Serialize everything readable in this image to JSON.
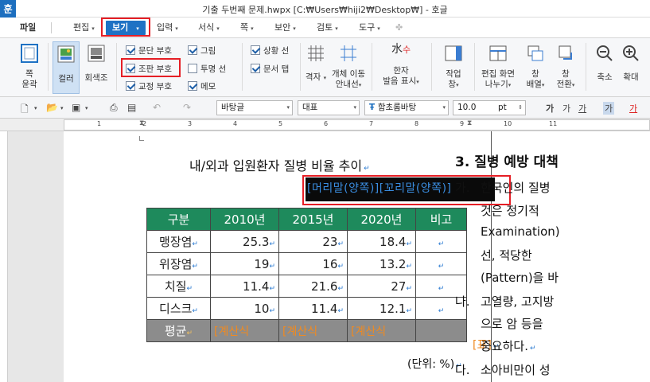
{
  "window": {
    "app_icon": "훈",
    "title": "기출 두번째 문제.hwpx [C:₩Users₩hiji2₩Desktop₩] - 호글"
  },
  "menu": {
    "file": "파일",
    "edit": "편집",
    "view": "보기",
    "input": "입력",
    "format": "서식",
    "page": "쪽",
    "security": "보안",
    "review": "검토",
    "tools": "도구"
  },
  "ribbon": {
    "page_outline": [
      "쪽",
      "윤곽"
    ],
    "color": "컬러",
    "grayscale": "회색조",
    "checks": {
      "paragraph_mark": {
        "label": "문단 부호",
        "checked": true
      },
      "markup_mark": {
        "label": "조판 부호",
        "checked": true
      },
      "proof_mark": {
        "label": "교정 부호",
        "checked": true
      },
      "picture": {
        "label": "그림",
        "checked": true
      },
      "transparent_line": {
        "label": "투명 선",
        "checked": false
      },
      "memo": {
        "label": "메모",
        "checked": true
      },
      "status_line": {
        "label": "상황 선",
        "checked": true
      },
      "doc_tab": {
        "label": "문서 탭",
        "checked": true
      }
    },
    "grid": "격자",
    "object_move": [
      "개체 이동",
      "안내선"
    ],
    "hanja": [
      "한자",
      "발음 표시"
    ],
    "work_window": [
      "작업",
      "창"
    ],
    "split_screen": [
      "편집 화면",
      "나누기"
    ],
    "window_arrange": [
      "창",
      "배열"
    ],
    "window_switch": [
      "창",
      "전환"
    ],
    "zoom_out": "축소",
    "zoom_in": "확대"
  },
  "format_bar": {
    "style": "바탕글",
    "lang": "대표",
    "font": "함초롬바탕",
    "size": "10.0",
    "unit": "pt"
  },
  "ruler": {
    "numbers": [
      "1",
      "2",
      "3",
      "4",
      "5",
      "6",
      "7",
      "8",
      "9",
      "10",
      "11"
    ]
  },
  "document": {
    "title": "내/외과 입원환자 질병 비율 추이",
    "fields": "[머리말(양쪽)][꼬리말(양쪽)]",
    "table": {
      "headers": [
        "구분",
        "2010년",
        "2015년",
        "2020년",
        "비고"
      ],
      "rows": [
        [
          "맹장염",
          "25.3",
          "23",
          "18.4",
          ""
        ],
        [
          "위장염",
          "19",
          "16",
          "13.2",
          ""
        ],
        [
          "치질",
          "11.4",
          "21.6",
          "27",
          ""
        ],
        [
          "디스크",
          "10",
          "11.4",
          "12.1",
          ""
        ]
      ],
      "avg_label": "평균",
      "calc_label": "[계산식"
    },
    "table_tag": "[표]",
    "unit_note": "(단위: %)"
  },
  "right_column": {
    "heading": "3. 질병 예방 대책",
    "item_ga_label": "가.",
    "item_ga": [
      "한국인의 질병",
      "것은    정기적",
      "Examination)",
      "선,  적당한",
      "(Pattern)을 바"
    ],
    "item_na_label": "나.",
    "item_na": [
      "고열량, 고지방",
      "으로 암 등을",
      "중요하다."
    ],
    "item_da_label": "다.",
    "item_da": [
      "소아비만이 성"
    ]
  },
  "colors": {
    "accent": "#1f72c4",
    "table_header": "#1e8a5c",
    "avg_row": "#8c8c8c",
    "calc_text": "#f08a20",
    "highlight": "#e51e25"
  }
}
